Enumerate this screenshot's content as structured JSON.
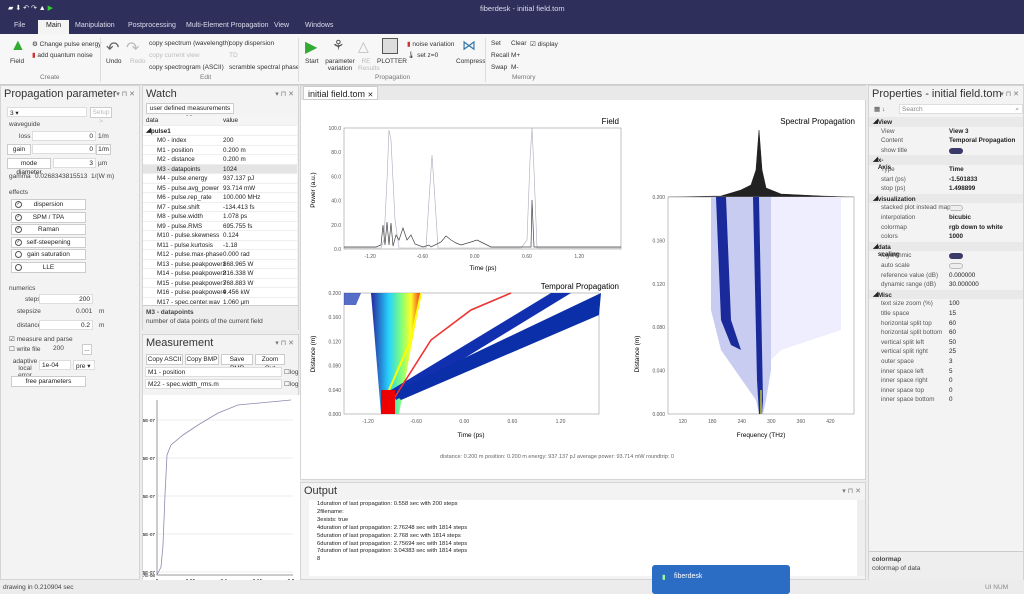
{
  "window": {
    "title": "fiberdesk - initial field.tom"
  },
  "tabs": [
    "File",
    "Main",
    "Manipulation",
    "Postprocessing",
    "Multi-Element Propagation",
    "View",
    "Windows"
  ],
  "ribbon": {
    "create": {
      "field": "Field",
      "change_energy": "Change pulse energy",
      "add_noise": "add quantum noise",
      "group": "Create"
    },
    "edit": {
      "undo": "Undo",
      "redo": "Redo",
      "copy_spectrum": "copy spectrum (wavelength)",
      "copy_view": "copy current view",
      "copy_spectrogram": "copy spectrogram (ASCII)",
      "copy_dispersion": "copy dispersion",
      "td": "TD",
      "scramble": "scramble spectral phase",
      "group": "Edit"
    },
    "propagation": {
      "start": "Start",
      "param_var": "parameter variation",
      "re_results": "RE Results",
      "plotter": "PLOTTER",
      "noise_var": "noise variation",
      "set_z0": "set z=0",
      "compress": "Compress",
      "group": "Propagation"
    },
    "memory": {
      "set": "Set",
      "recall": "Recall",
      "swap": "Swap",
      "clear": "Clear",
      "mplus": "M+",
      "mminus": "M-",
      "display": "display",
      "group": "Memory"
    }
  },
  "prop_panel": {
    "title": "Propagation parameter",
    "mode": "3",
    "setup": "Setup >",
    "waveguide": "waveguide",
    "loss_label": "loss",
    "loss": "0",
    "loss_unit": "1/m",
    "gain_label": "gain",
    "gain": "0",
    "gain_unit": "1/m",
    "mode_label": "mode diameter",
    "mode_unit": "µm",
    "gamma_label": "gamma",
    "gamma": "0.0268343815513",
    "gamma_unit": "1/(W m)",
    "effects_label": "effects",
    "effects": [
      {
        "label": "dispersion",
        "on": true
      },
      {
        "label": "SPM / TPA",
        "on": true
      },
      {
        "label": "Raman",
        "on": true
      },
      {
        "label": "self-steepening",
        "on": true
      },
      {
        "label": "gain saturation",
        "on": false
      },
      {
        "label": "LLE",
        "on": false
      }
    ],
    "numerics": "numerics",
    "steps_label": "steps",
    "steps": "200",
    "stepsize_label": "stepsize",
    "stepsize": "0.001",
    "stepsize_unit": "m",
    "distance_label": "distance",
    "distance": "0.2",
    "distance_unit": "m",
    "measure": "measure and parse",
    "write_file": "write file",
    "write_n": "200",
    "browse": "...",
    "adaptive": "adaptive local error",
    "adaptive_val": "1e-04",
    "pre": "pre",
    "free": "free parameters"
  },
  "watch": {
    "title": "Watch",
    "udm": "user defined measurements >>",
    "col_data": "data",
    "col_value": "value",
    "group": "pulse1",
    "rows": [
      [
        "M0 - index",
        "200"
      ],
      [
        "M1 - position",
        "0.200  m"
      ],
      [
        "M2 - distance",
        "0.200  m"
      ],
      [
        "M3 - datapoints",
        "1024"
      ],
      [
        "M4 - pulse.energy",
        "937.137 pJ"
      ],
      [
        "M5 - pulse.avg_power",
        "93.714 mW"
      ],
      [
        "M6 - pulse.rep_rate",
        "100.000 MHz"
      ],
      [
        "M7 - pulse.shift",
        "-134.413 fs"
      ],
      [
        "M8 - pulse.width",
        "1.078 ps"
      ],
      [
        "M9 - pulse.RMS",
        "695.755 fs"
      ],
      [
        "M10 - pulse.skewness",
        "0.124"
      ],
      [
        "M11 - pulse.kurtosis",
        "-1.18"
      ],
      [
        "M12 - pulse.max-phase",
        "0.000 rad"
      ],
      [
        "M13 - pulse.peakpower1",
        "868.965  W"
      ],
      [
        "M14 - pulse.peakpower2",
        "816.338  W"
      ],
      [
        "M15 - pulse.peakpower3",
        "768.883  W"
      ],
      [
        "M16 - pulse.peakpower4",
        "9.456 kW"
      ],
      [
        "M17 - spec.center.wav",
        "1.060 µm"
      ]
    ],
    "desc_title": "M3 - datapoints",
    "desc": "number of data points of the current field"
  },
  "measurement": {
    "title": "Measurement",
    "copy_ascii": "Copy ASCII",
    "copy_bmp": "Copy BMP",
    "save_bmp": "Save BMP",
    "zoom_out": "Zoom Out",
    "x_sel": "M1 - position",
    "y_sel": "M22 - spec.width_rms.m",
    "log": "log",
    "yticks": [
      "5.14040725E-07",
      "4.14040725E-07",
      "3.14040725E-07",
      "2.14040725E-07",
      "1.14040725E-07",
      "1.40407247E-08"
    ],
    "xticks": [
      "0",
      "0.05",
      "0.1",
      "0.15",
      "0.2"
    ]
  },
  "document": {
    "tab": "initial field.tom",
    "field": {
      "title": "Field",
      "ylabel": "Power (a.u.)",
      "xlabel": "Time (ps)",
      "yticks": [
        "100.0",
        "80.0",
        "60.0",
        "40.0",
        "20.0",
        "0.0"
      ],
      "xticks": [
        "-1.20",
        "-0.60",
        "0.00",
        "0.60",
        "1.20"
      ]
    },
    "temporal": {
      "title": "Temporal Propagation",
      "ylabel": "Distance (m)",
      "xlabel": "Time (ps)",
      "yticks": [
        "0.200",
        "0.160",
        "0.120",
        "0.080",
        "0.040",
        "0.000"
      ],
      "xticks": [
        "-1.20",
        "-0.60",
        "0.00",
        "0.60",
        "1.20"
      ]
    },
    "spectral": {
      "title": "Spectral Propagation",
      "ylabel": "Distance (m)",
      "xlabel": "Frequency (THz)",
      "yticks": [
        "0.200",
        "0.160",
        "0.120",
        "0.080",
        "0.040",
        "0.000"
      ],
      "xticks": [
        "120",
        "180",
        "240",
        "300",
        "360",
        "420"
      ]
    },
    "status": "distance: 0.200  m   position: 0.200  m   energy: 937.137 pJ   average power: 93.714 mW   roundtrip: 0"
  },
  "output": {
    "title": "Output",
    "lines": [
      "1duration of last propagation: 0.558 sec with 200 steps",
      "2filename:",
      "3exists: true",
      "4duration of last propagation: 2.76248 sec with 1814 steps",
      "5duration of last propagation: 2.768 sec with 1814 steps",
      "6duration of last propagation: 2.75694 sec with 1814 steps",
      "7duration of last propagation: 3.04383 sec with 1814 steps",
      "8"
    ]
  },
  "properties": {
    "title": "Properties - initial field.tom",
    "search": "Search",
    "rows": [
      [
        "cat",
        "View",
        ""
      ],
      [
        "p",
        "View",
        "View 3"
      ],
      [
        "p",
        "Content",
        "Temporal Propagation"
      ],
      [
        "t",
        "show title",
        "on"
      ],
      [
        "cat",
        "x-Axis",
        ""
      ],
      [
        "p",
        "Type",
        "Time"
      ],
      [
        "p",
        "start (ps)",
        "-1.501833"
      ],
      [
        "p",
        "stop (ps)",
        "1.498899"
      ],
      [
        "cat",
        "visualization",
        ""
      ],
      [
        "t",
        "stacked plot instead map",
        "off"
      ],
      [
        "p",
        "interpolation",
        "bicubic"
      ],
      [
        "p",
        "colormap",
        "rgb down to white"
      ],
      [
        "p",
        "colors",
        "1000"
      ],
      [
        "cat",
        "data scaling",
        ""
      ],
      [
        "t",
        "logarithmic",
        "on"
      ],
      [
        "t",
        "auto scale",
        "off"
      ],
      [
        "p",
        "reference value (dB)",
        "0.000000"
      ],
      [
        "p",
        "dynamic range (dB)",
        "30.000000"
      ],
      [
        "cat",
        "Misc",
        ""
      ],
      [
        "p",
        "text size zoom (%)",
        "100"
      ],
      [
        "p",
        "title space",
        "15"
      ],
      [
        "p",
        "horizontal split top",
        "60"
      ],
      [
        "p",
        "horizontal split bottom",
        "60"
      ],
      [
        "p",
        "vertical split left",
        "50"
      ],
      [
        "p",
        "vertical split right",
        "25"
      ],
      [
        "p",
        "outer space",
        "3"
      ],
      [
        "p",
        "inner space left",
        "5"
      ],
      [
        "p",
        "inner space right",
        "0"
      ],
      [
        "p",
        "inner space top",
        "0"
      ],
      [
        "p",
        "inner space bottom",
        "0"
      ]
    ],
    "desc_title": "colormap",
    "desc": "colormap of data"
  },
  "statusbar": {
    "left": "drawing in 0.210904 sec",
    "right": "UI NUM"
  },
  "toast": {
    "app": "fiberdesk"
  }
}
